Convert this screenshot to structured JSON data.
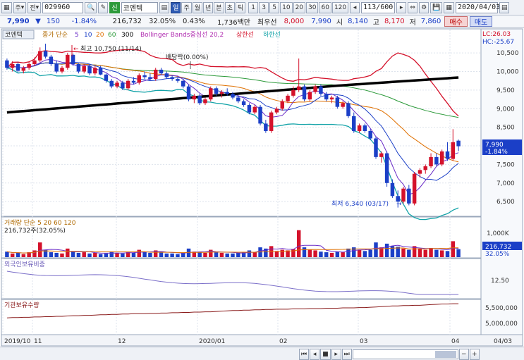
{
  "toolbar": {
    "code": "029960",
    "company_tag": "신",
    "company": "코엔텍",
    "periods": [
      "일",
      "주",
      "월",
      "년",
      "분",
      "초",
      "틱"
    ],
    "active_period": "일",
    "numbers": [
      "1",
      "3",
      "5",
      "10",
      "20",
      "30",
      "60",
      "120"
    ],
    "count": "113/600",
    "date": "2020/04/03",
    "menu_1": "주",
    "menu_2": "전"
  },
  "quote": {
    "price": "7,990",
    "change": "150",
    "change_pct": "-1.84%",
    "volume": "216,732",
    "volume_ratio": "32.05%",
    "turnover_rate": "0.43%",
    "trade_value": "1,736백만",
    "priority_label": "최우선",
    "bid": "8,000",
    "ask": "7,990",
    "open_label": "시",
    "open": "8,140",
    "high_label": "고",
    "high": "8,170",
    "low_label": "저",
    "low": "7,860",
    "buy_label": "매수",
    "sell_label": "매도"
  },
  "price_panel": {
    "stock_name": "코엔텍",
    "legend_prefix": "종가 단순",
    "ma_periods": [
      "5",
      "10",
      "20",
      "60",
      "300"
    ],
    "bollinger_label": "Bollinger Bands중심선 20,2",
    "upper_label": "상한선",
    "lower_label": "하한선",
    "lc": "LC:26.03",
    "hc": "HC:-25.67",
    "high_annotation": "최고 10,750 (11/14)",
    "dividend_annotation": "배당락(0.00%)",
    "low_annotation": "최저 6,340 (03/17)",
    "current_price": "7,990",
    "current_change": "-1.84%",
    "axis_labels": [
      "10,500",
      "10,000",
      "9,500",
      "9,000",
      "8,500",
      "8,000",
      "7,500",
      "7,000",
      "6,500"
    ]
  },
  "volume_panel": {
    "legend": "거래량 단순 5 20 60 120",
    "sub_legend": "216,732주(32.05%)",
    "axis_label": "1,000K",
    "current": "216,732",
    "current_pct": "32.05%"
  },
  "foreign_panel": {
    "legend": "외국인보유비중",
    "axis_label": "12.50"
  },
  "inst_panel": {
    "legend": "기관보유수량",
    "axis_labels": [
      "5,500,000",
      "5,000,000"
    ]
  },
  "date_axis": {
    "labels": [
      "2019/10",
      "11",
      "12",
      "2020/01",
      "02",
      "03",
      "04"
    ],
    "end_label": "04/03"
  },
  "chart_data": {
    "type": "candlestick",
    "ylim": [
      6200,
      10750
    ],
    "candles": [
      [
        10300,
        10350,
        10050,
        10100
      ],
      [
        10100,
        10280,
        10000,
        10200
      ],
      [
        10200,
        10250,
        9980,
        10020
      ],
      [
        10020,
        10150,
        9950,
        10100
      ],
      [
        10100,
        10250,
        10050,
        10200
      ],
      [
        10200,
        10380,
        10150,
        10300
      ],
      [
        10300,
        10650,
        10250,
        10550
      ],
      [
        10550,
        10750,
        10350,
        10400
      ],
      [
        10400,
        10450,
        10150,
        10200
      ],
      [
        10200,
        10300,
        9950,
        10000
      ],
      [
        10000,
        10150,
        9950,
        10100
      ],
      [
        10100,
        10500,
        10050,
        10450
      ],
      [
        10450,
        10480,
        10150,
        10200
      ],
      [
        10200,
        10220,
        9950,
        10000
      ],
      [
        10000,
        10200,
        9950,
        10150
      ],
      [
        10150,
        10200,
        9900,
        9950
      ],
      [
        9950,
        10150,
        9900,
        10100
      ],
      [
        10100,
        10150,
        9900,
        9920
      ],
      [
        9920,
        9950,
        9700,
        9750
      ],
      [
        9750,
        9800,
        9550,
        9600
      ],
      [
        9600,
        9750,
        9550,
        9700
      ],
      [
        9700,
        9750,
        9500,
        9550
      ],
      [
        9550,
        9800,
        9500,
        9750
      ],
      [
        9750,
        9850,
        9650,
        9700
      ],
      [
        9700,
        9950,
        9650,
        9900
      ],
      [
        9900,
        10000,
        9800,
        9850
      ],
      [
        9850,
        9950,
        9750,
        9800
      ],
      [
        9800,
        10100,
        9750,
        10050
      ],
      [
        10050,
        10100,
        9900,
        9950
      ],
      [
        9950,
        10000,
        9800,
        9850
      ],
      [
        9850,
        9900,
        9750,
        9800
      ],
      [
        9800,
        9850,
        9700,
        9750
      ],
      [
        9750,
        9800,
        9550,
        9600
      ],
      [
        9600,
        9650,
        9200,
        9250
      ],
      [
        9250,
        9400,
        9150,
        9350
      ],
      [
        9350,
        9400,
        9100,
        9150
      ],
      [
        9150,
        9300,
        9100,
        9250
      ],
      [
        9250,
        9600,
        9200,
        9550
      ],
      [
        9550,
        9600,
        9350,
        9400
      ],
      [
        9400,
        9500,
        9300,
        9450
      ],
      [
        9450,
        9550,
        9350,
        9400
      ],
      [
        9400,
        9450,
        9250,
        9300
      ],
      [
        9300,
        9350,
        9150,
        9200
      ],
      [
        9200,
        9250,
        9050,
        9100
      ],
      [
        9100,
        9150,
        8850,
        8900
      ],
      [
        8900,
        9100,
        8850,
        9050
      ],
      [
        9050,
        9100,
        8550,
        8600
      ],
      [
        8600,
        8700,
        8350,
        8400
      ],
      [
        8400,
        8950,
        8350,
        8900
      ],
      [
        8900,
        9050,
        8850,
        9000
      ],
      [
        9000,
        9250,
        8950,
        9200
      ],
      [
        9200,
        9400,
        9150,
        9350
      ],
      [
        9350,
        9600,
        9300,
        9500
      ],
      [
        9500,
        10350,
        9450,
        9600
      ],
      [
        9600,
        9650,
        9200,
        9250
      ],
      [
        9250,
        9500,
        9200,
        9450
      ],
      [
        9450,
        9650,
        9400,
        9600
      ],
      [
        9600,
        9650,
        9350,
        9400
      ],
      [
        9400,
        9450,
        9200,
        9250
      ],
      [
        9250,
        9350,
        9150,
        9300
      ],
      [
        9300,
        9350,
        9000,
        9050
      ],
      [
        9050,
        9200,
        9000,
        9150
      ],
      [
        9150,
        9200,
        8750,
        8800
      ],
      [
        8800,
        8900,
        8350,
        8400
      ],
      [
        8400,
        8600,
        8350,
        8550
      ],
      [
        8550,
        8600,
        8350,
        8400
      ],
      [
        8400,
        8450,
        8150,
        8200
      ],
      [
        8200,
        8250,
        7650,
        7700
      ],
      [
        7700,
        7850,
        7550,
        7800
      ],
      [
        7800,
        7850,
        6900,
        7000
      ],
      [
        7000,
        7100,
        6600,
        6650
      ],
      [
        6650,
        6800,
        6340,
        6500
      ],
      [
        6500,
        6900,
        6450,
        6850
      ],
      [
        6850,
        6950,
        6400,
        6450
      ],
      [
        6450,
        7300,
        6400,
        7250
      ],
      [
        7250,
        7400,
        7150,
        7350
      ],
      [
        7350,
        7500,
        7250,
        7450
      ],
      [
        7450,
        7800,
        7400,
        7700
      ],
      [
        7700,
        7800,
        7450,
        7500
      ],
      [
        7500,
        7900,
        7450,
        7850
      ],
      [
        7850,
        8100,
        7600,
        7650
      ],
      [
        7650,
        8450,
        7600,
        8100
      ],
      [
        8140,
        8170,
        7860,
        7990
      ]
    ],
    "volumes": [
      45,
      30,
      35,
      25,
      40,
      55,
      120,
      60,
      40,
      35,
      30,
      70,
      45,
      35,
      40,
      30,
      35,
      25,
      30,
      45,
      35,
      30,
      40,
      35,
      60,
      45,
      35,
      55,
      40,
      30,
      30,
      25,
      35,
      70,
      45,
      40,
      35,
      60,
      40,
      35,
      30,
      30,
      35,
      40,
      55,
      40,
      80,
      70,
      90,
      50,
      60,
      55,
      65,
      220,
      80,
      60,
      55,
      45,
      40,
      35,
      45,
      40,
      70,
      80,
      60,
      50,
      60,
      120,
      80,
      110,
      90,
      85,
      70,
      60,
      90,
      70,
      60,
      75,
      60,
      55,
      50,
      130,
      65
    ],
    "inst_holding": [
      0.45,
      0.46,
      0.46,
      0.47,
      0.47,
      0.48,
      0.48,
      0.49,
      0.49,
      0.5,
      0.5,
      0.51,
      0.52,
      0.52,
      0.53,
      0.53,
      0.54,
      0.55,
      0.55,
      0.56,
      0.56,
      0.57,
      0.57,
      0.58,
      0.58,
      0.58,
      0.59,
      0.59,
      0.6,
      0.6,
      0.61,
      0.61,
      0.62,
      0.62,
      0.63,
      0.63,
      0.64,
      0.64,
      0.65,
      0.66,
      0.67,
      0.68,
      0.68,
      0.69,
      0.69,
      0.7,
      0.7,
      0.71,
      0.71,
      0.72,
      0.72,
      0.72,
      0.73,
      0.73,
      0.73,
      0.74,
      0.74,
      0.74,
      0.75,
      0.75,
      0.75,
      0.76,
      0.76,
      0.76,
      0.77,
      0.77,
      0.78,
      0.79,
      0.8,
      0.81,
      0.82,
      0.82,
      0.83,
      0.83,
      0.84,
      0.84,
      0.85,
      0.86,
      0.87,
      0.88,
      0.88,
      0.89,
      0.89
    ]
  },
  "colors": {
    "up": "#d4122b",
    "down": "#1b3fc7",
    "grid": "#dde3ec",
    "ma300": "#000000"
  }
}
